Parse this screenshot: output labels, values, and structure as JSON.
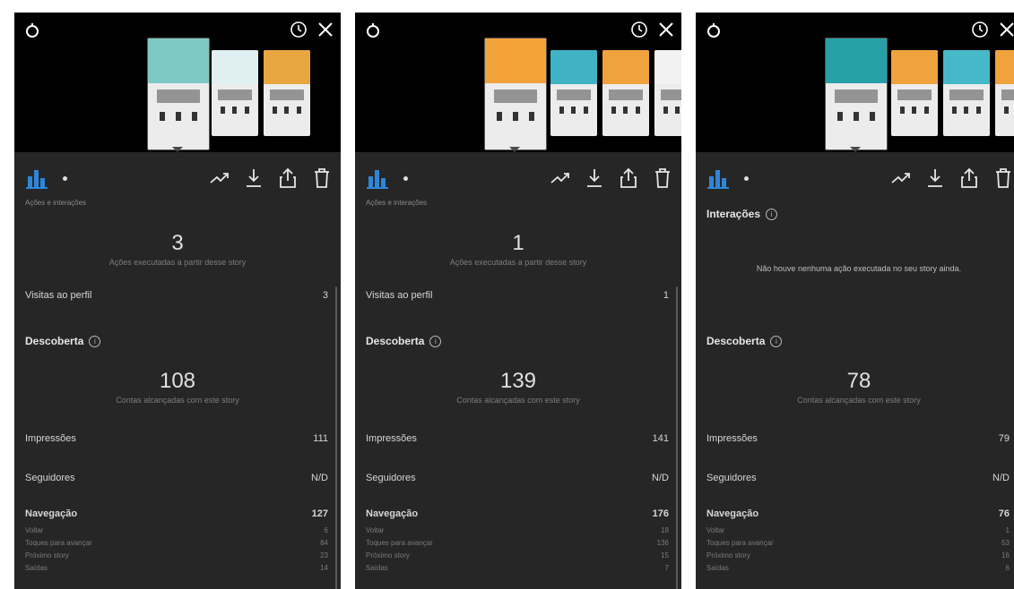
{
  "colors": {
    "accent_blue": "#2e86d9",
    "panel_bg": "#262626",
    "top_bg": "#000000"
  },
  "icons": {
    "top_left": "loader-icon",
    "top_right": [
      "timer-icon",
      "close-icon"
    ],
    "toolbar_left": "bar-chart-icon",
    "toolbar_right": [
      "trending-icon",
      "download-icon",
      "share-icon",
      "delete-icon"
    ]
  },
  "panels": [
    {
      "thumbnails": [
        {
          "color": "#7fc9c5",
          "selected": true
        },
        {
          "color": "#dfeff2",
          "selected": false
        },
        {
          "color": "#e8a640",
          "selected": false
        }
      ],
      "cut_text": "Ações e interações",
      "interactions": {
        "title": "",
        "value": "3",
        "caption": "Ações executadas a partir desse story",
        "message": "",
        "profile_visits_label": "Visitas ao perfil",
        "profile_visits_value": "3"
      },
      "discovery": {
        "title": "Descoberta",
        "value": "108",
        "caption": "Contas alcançadas com este story",
        "impressions_label": "Impressões",
        "impressions_value": "111",
        "followers_label": "Seguidores",
        "followers_value": "N/D",
        "navigation_label": "Navegação",
        "navigation_value": "127",
        "nav_items": [
          {
            "label": "Voltar",
            "value": "6"
          },
          {
            "label": "Toques para avançar",
            "value": "84"
          },
          {
            "label": "Próximo story",
            "value": "23"
          },
          {
            "label": "Saídas",
            "value": "14"
          }
        ]
      }
    },
    {
      "thumbnails": [
        {
          "color": "#f2a33a",
          "selected": true
        },
        {
          "color": "#3fb3c4",
          "selected": false
        },
        {
          "color": "#f0a23c",
          "selected": false
        },
        {
          "color": "#f2f2f2",
          "selected": false
        }
      ],
      "cut_text": "Ações e interações",
      "interactions": {
        "title": "",
        "value": "1",
        "caption": "Ações executadas a partir desse story",
        "message": "",
        "profile_visits_label": "Visitas ao perfil",
        "profile_visits_value": "1"
      },
      "discovery": {
        "title": "Descoberta",
        "value": "139",
        "caption": "Contas alcançadas com este story",
        "impressions_label": "Impressões",
        "impressions_value": "141",
        "followers_label": "Seguidores",
        "followers_value": "N/D",
        "navigation_label": "Navegação",
        "navigation_value": "176",
        "nav_items": [
          {
            "label": "Voltar",
            "value": "18"
          },
          {
            "label": "Toques para avançar",
            "value": "136"
          },
          {
            "label": "Próximo story",
            "value": "15"
          },
          {
            "label": "Saídas",
            "value": "7"
          }
        ]
      }
    },
    {
      "thumbnails": [
        {
          "color": "#27a0a6",
          "selected": true
        },
        {
          "color": "#f0a23c",
          "selected": false
        },
        {
          "color": "#45b9c8",
          "selected": false
        },
        {
          "color": "#f0a23c",
          "selected": false
        }
      ],
      "cut_text": "",
      "interactions": {
        "title": "Interações",
        "value": "",
        "caption": "",
        "message": "Não houve nenhuma ação executada no seu story ainda.",
        "profile_visits_label": "",
        "profile_visits_value": ""
      },
      "discovery": {
        "title": "Descoberta",
        "value": "78",
        "caption": "Contas alcançadas com este story",
        "impressions_label": "Impressões",
        "impressions_value": "79",
        "followers_label": "Seguidores",
        "followers_value": "N/D",
        "navigation_label": "Navegação",
        "navigation_value": "76",
        "nav_items": [
          {
            "label": "Voltar",
            "value": "1"
          },
          {
            "label": "Toques para avançar",
            "value": "53"
          },
          {
            "label": "Próximo story",
            "value": "16"
          },
          {
            "label": "Saídas",
            "value": "6"
          }
        ]
      }
    }
  ]
}
